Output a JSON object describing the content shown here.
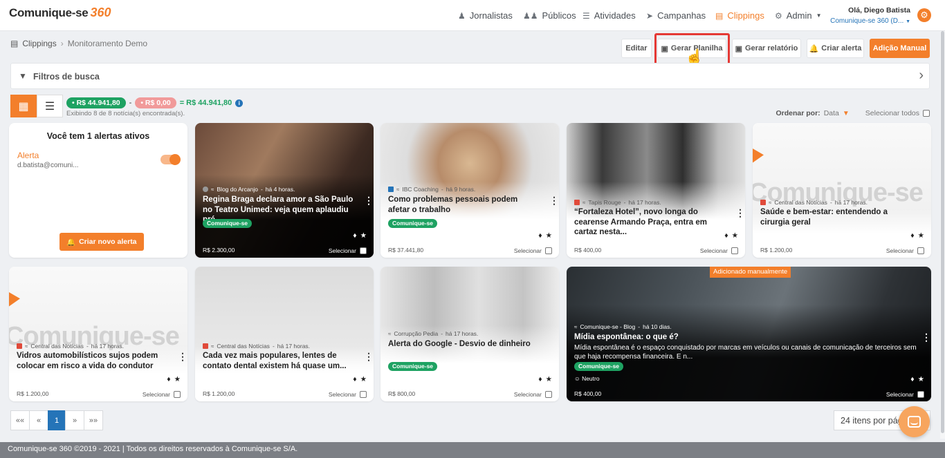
{
  "header": {
    "logo_text": "Comunique-se",
    "logo_num": "360",
    "nav": [
      {
        "label": "Jornalistas",
        "icon": "user-icon"
      },
      {
        "label": "Públicos",
        "icon": "users-icon"
      },
      {
        "label": "Atividades",
        "icon": "list-check-icon"
      },
      {
        "label": "Campanhas",
        "icon": "paper-plane-icon"
      },
      {
        "label": "Clippings",
        "icon": "newspaper-icon",
        "active": true
      },
      {
        "label": "Admin",
        "icon": "gear-icon"
      }
    ],
    "user_greeting": "Olá, Diego Batista",
    "user_org": "Comunique-se 360 (D..."
  },
  "breadcrumb": {
    "root": "Clippings",
    "current": "Monitoramento Demo"
  },
  "toolbar": {
    "edit": "Editar",
    "spreadsheet": "Gerar Planilha",
    "report": "Gerar relatório",
    "alert": "Criar alerta",
    "manual": "Adição Manual"
  },
  "filters": {
    "label": "Filtros de busca"
  },
  "summary": {
    "positive": "R$ 44.941,80",
    "minus": "-",
    "negative": "R$ 0,00",
    "total": "= R$ 44.941,80",
    "showing": "Exibindo 8 de 8 notícia(s) encontrada(s)."
  },
  "sort": {
    "label": "Ordenar por:",
    "value": "Data",
    "select_all": "Selecionar todos"
  },
  "alert_card": {
    "title": "Você tem 1 alertas ativos",
    "alert_name": "Alerta",
    "alert_email": "d.batista@comuni...",
    "button": "Criar novo alerta"
  },
  "cards": [
    {
      "source": "Blog do Arcanjo",
      "time": "há 4 horas.",
      "title": "Regina Braga declara amor a São Paulo no Teatro Unimed: veja quem aplaudiu pré...",
      "tag": "Comunique-se",
      "price": "R$ 2.300,00",
      "select": "Selecionar"
    },
    {
      "source": "IBC Coaching",
      "time": "há 9 horas.",
      "title": "Como problemas pessoais podem afetar o trabalho",
      "tag": "Comunique-se",
      "price": "R$ 37.441,80",
      "select": "Selecionar"
    },
    {
      "source": "Tapis Rouge",
      "time": "há 17 horas.",
      "title": "“Fortaleza Hotel”, novo longa do cearense Armando Praça, entra em cartaz nesta...",
      "price": "R$ 400,00",
      "select": "Selecionar"
    },
    {
      "source": "Central das Notícias",
      "time": "há 17 horas.",
      "title": "Saúde e bem-estar: entendendo a cirurgia geral",
      "price": "R$ 1.200,00",
      "select": "Selecionar"
    },
    {
      "source": "Central das Notícias",
      "time": "há 17 horas.",
      "title": "Vidros automobilísticos sujos podem colocar em risco a vida do condutor",
      "price": "R$ 1.200,00",
      "select": "Selecionar"
    },
    {
      "source": "Central das Notícias",
      "time": "há 17 horas.",
      "title": "Cada vez mais populares, lentes de contato dental existem há quase um...",
      "price": "R$ 1.200,00",
      "select": "Selecionar"
    },
    {
      "source": "Corrupção Pedia",
      "time": "há 17 horas.",
      "title": "Alerta do Google - Desvio de dinheiro",
      "tag": "Comunique-se",
      "price": "R$ 800,00",
      "select": "Selecionar"
    },
    {
      "badge": "Adicionado manualmente",
      "source": "Comunique-se - Blog",
      "time": "há 10 dias.",
      "title": "Mídia espontânea: o que é?",
      "description": "Mídia espontânea é o espaço conquistado por marcas em veículos ou canais de comunicação de terceiros sem que haja recompensa financeira. E n...",
      "tag": "Comunique-se",
      "sentiment": "Neutro",
      "price": "R$ 400,00",
      "select": "Selecionar"
    }
  ],
  "placeholder_logo": "Comunique-se",
  "pagination": {
    "first": "««",
    "prev": "«",
    "current": "1",
    "next": "»",
    "last": "»»"
  },
  "per_page": "24 itens por página",
  "footer": "Comunique-se 360 ©2019 - 2021 | Todos os direitos reservados à Comunique-se S/A.",
  "colors": {
    "accent": "#f37f2b",
    "success": "#1ea262",
    "link": "#2574b8",
    "footer": "#7c7f85"
  }
}
